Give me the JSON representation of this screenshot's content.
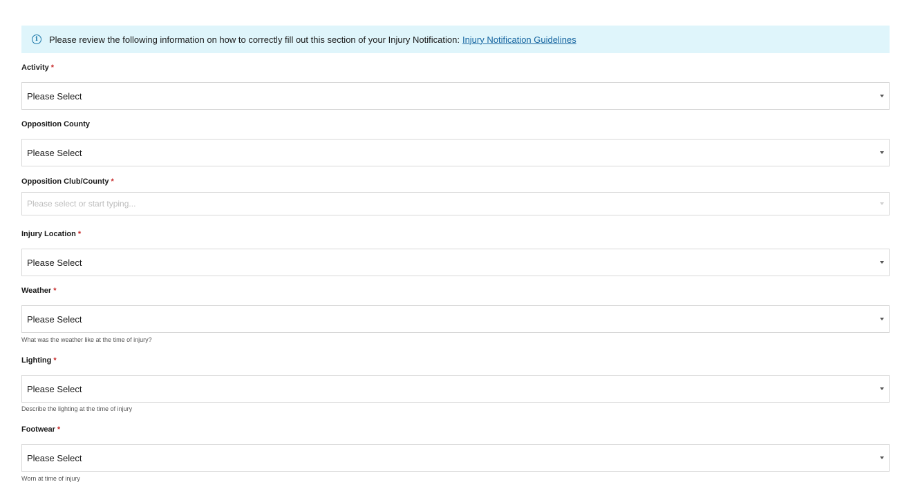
{
  "banner": {
    "text": "Please review the following information on how to correctly fill out this section of your Injury Notification:",
    "link": "Injury Notification Guidelines",
    "icon": "info-icon"
  },
  "fields": {
    "activity": {
      "label": "Activity",
      "required": "*",
      "value": "Please Select"
    },
    "opposition_county": {
      "label": "Opposition County",
      "value": "Please Select"
    },
    "opposition_club": {
      "label": "Opposition Club/County",
      "required": "*",
      "placeholder": "Please select or start typing..."
    },
    "injury_location": {
      "label": "Injury Location",
      "required": "*",
      "value": "Please Select"
    },
    "weather": {
      "label": "Weather",
      "required": "*",
      "value": "Please Select",
      "help": "What was the weather like at the time of injury?"
    },
    "lighting": {
      "label": "Lighting",
      "required": "*",
      "value": "Please Select",
      "help": "Describe the lighting at the time of injury"
    },
    "footwear": {
      "label": "Footwear",
      "required": "*",
      "value": "Please Select",
      "help": "Worn at time of injury"
    }
  }
}
